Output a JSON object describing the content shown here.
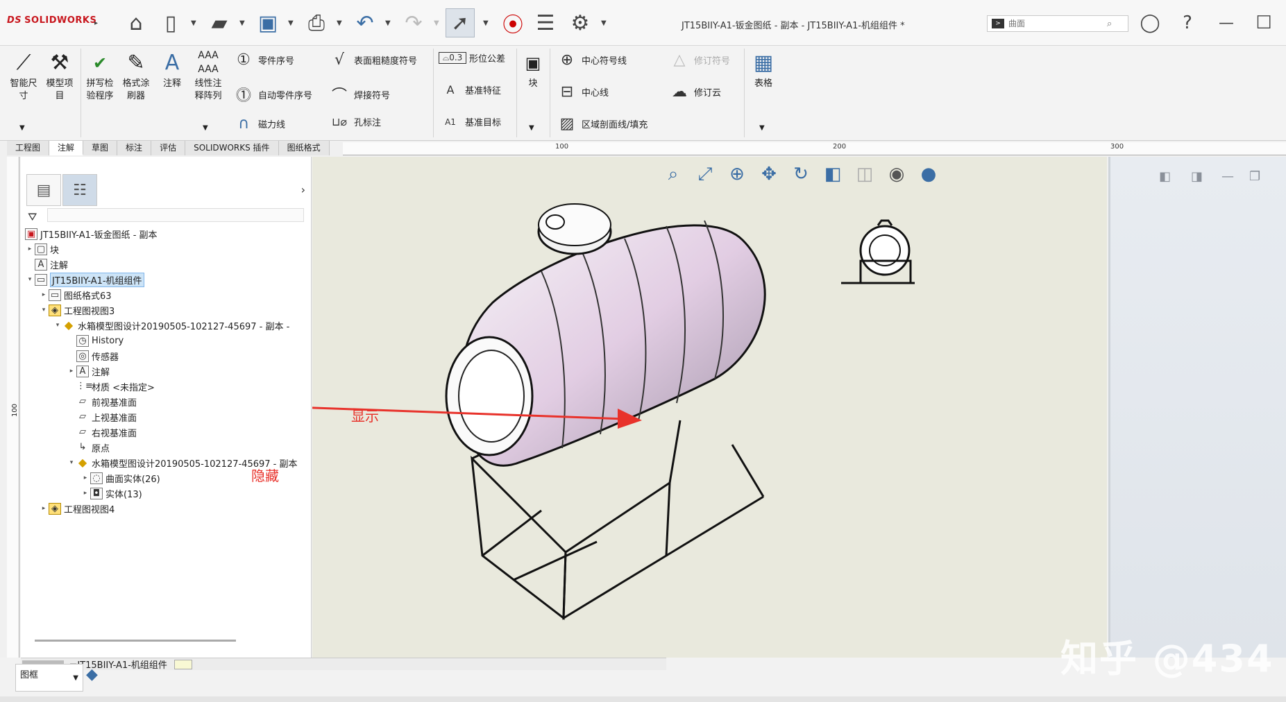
{
  "app": {
    "logo": "SOLIDWORKS",
    "doc_title": "JT15BIIY-A1-钣金图纸 - 副本 - JT15BIIY-A1-机组组件 *",
    "search_placeholder": "曲面"
  },
  "toolbar_icons": [
    "home-icon",
    "new-icon",
    "open-icon",
    "save-icon",
    "print-icon",
    "undo-icon",
    "redo-icon",
    "select-icon",
    "rebuild-icon",
    "options-list-icon",
    "gear-icon"
  ],
  "command_manager": {
    "big": [
      {
        "label": "智能尺\n寸"
      },
      {
        "label": "模型项\n目"
      },
      {
        "label": "拼写检\n验程序"
      },
      {
        "label": "格式涂\n刷器"
      },
      {
        "label": "注释"
      },
      {
        "label": "线性注\n释阵列"
      }
    ],
    "col1": [
      "零件序号",
      "自动零件序号",
      "磁力线"
    ],
    "col2": [
      "表面粗糙度符号",
      "焊接符号",
      "孔标注"
    ],
    "col3": [
      "形位公差",
      "基准特征",
      "基准目标"
    ],
    "block": "块",
    "col4": [
      "中心符号线",
      "中心线",
      "区域剖面线/填充"
    ],
    "col5": [
      "修订符号",
      "修订云"
    ],
    "table": "表格",
    "gtol_prefix": "0.3",
    "datum_letter": "A",
    "datum_target": "A1"
  },
  "tabs": [
    "工程图",
    "注解",
    "草图",
    "标注",
    "评估",
    "SOLIDWORKS 插件",
    "图纸格式"
  ],
  "ruler": {
    "h": [
      "100",
      "200",
      "300"
    ],
    "v": "100"
  },
  "tree": {
    "root": "JT15BIIY-A1-钣金图纸 - 副本",
    "items": [
      {
        "label": "块"
      },
      {
        "label": "注解"
      },
      {
        "label": "JT15BIIY-A1-机组组件"
      },
      {
        "label": "图纸格式63"
      },
      {
        "label": "工程图视图3"
      },
      {
        "label": "水箱模型图设计20190505-102127-45697 - 副本 -"
      },
      {
        "label": "History"
      },
      {
        "label": "传感器"
      },
      {
        "label": "注解"
      },
      {
        "label": "材质 <未指定>"
      },
      {
        "label": "前视基准面"
      },
      {
        "label": "上视基准面"
      },
      {
        "label": "右视基准面"
      },
      {
        "label": "原点"
      },
      {
        "label": "水箱模型图设计20190505-102127-45697 - 副本"
      },
      {
        "label": "曲面实体(26)"
      },
      {
        "label": "实体(13)"
      },
      {
        "label": "工程图视图4"
      }
    ]
  },
  "annotations": {
    "show": "显示",
    "hide": "隐藏"
  },
  "sheet_tab": "JT15BIIY-A1-机组组件",
  "layer": "图框",
  "watermark": "知乎 @434",
  "colors": {
    "accent_red": "#e8322b",
    "canvas_bg": "#e9e9dd",
    "selection": "#cde4f7"
  }
}
